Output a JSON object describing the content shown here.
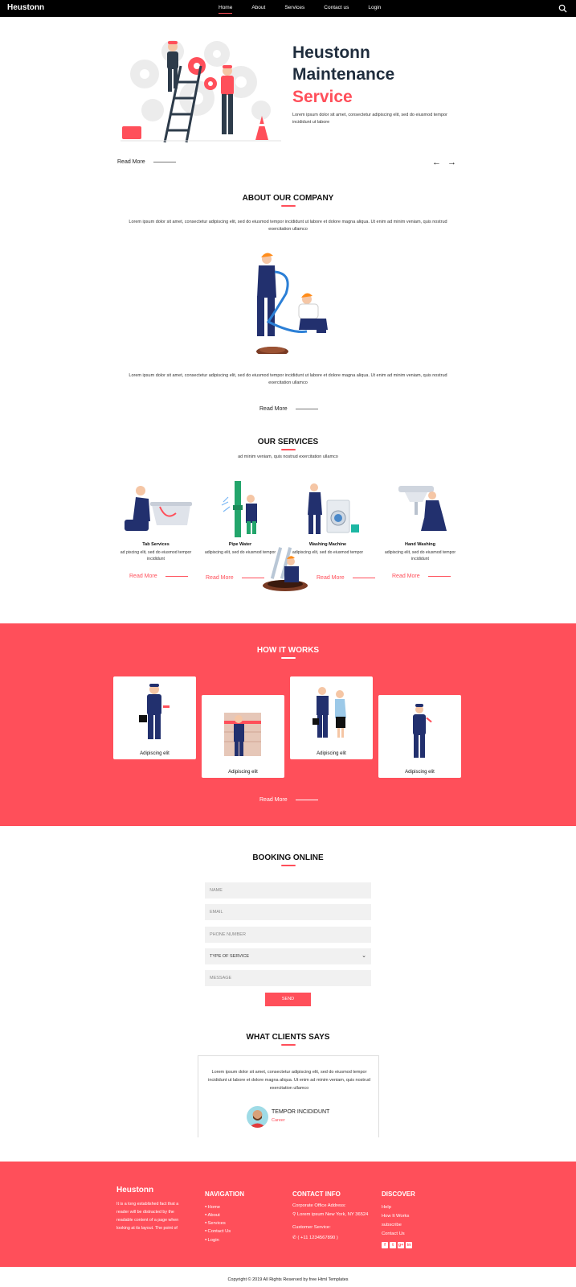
{
  "nav": {
    "brand": "Heustonn",
    "links": [
      "Home",
      "About",
      "Services",
      "Contact us",
      "Login"
    ],
    "active": "Home"
  },
  "hero": {
    "title_line1": "Heustonn",
    "title_line2": "Maintenance",
    "title_accent": "Service",
    "text": "Lorem ipsum dolor sit amet, consectetur adipiscing elit, sed do eiusmod tempor incididunt ut labore",
    "read_more": "Read More",
    "prev_arrow": "←",
    "next_arrow": "→"
  },
  "about": {
    "title": "ABOUT OUR COMPANY",
    "para1": "Lorem ipsum dolor sit amet, consectetur adipiscing elit, sed do eiusmod tempor incididunt ut labore et dolore magna aliqua. Ut enim ad minim veniam, quis nostrud exercitation ullamco",
    "para2": "Lorem ipsum dolor sit amet, consectetur adipiscing elit, sed do eiusmod tempor incididunt ut labore et dolore magna aliqua. Ut enim ad minim veniam, quis nostrud exercitation ullamco",
    "read_more": "Read More"
  },
  "services": {
    "title": "OUR SERVICES",
    "subtitle": "ad minim veniam, quis nostrud exercitation ullamco",
    "items": [
      {
        "name": "Tab Services",
        "desc": "ad piscing elit, sed do eiusmod tempor incididunt",
        "read_more": "Read More"
      },
      {
        "name": "Pipe Water",
        "desc": "adipiscing elit, sed do eiusmod tempor",
        "read_more": "Read More"
      },
      {
        "name": "Washing Machine",
        "desc": "adipiscing elit, sed do eiusmod tempor",
        "read_more": "Read More"
      },
      {
        "name": "Hand Washing",
        "desc": "adipiscing elit, sed do eiusmod tempor incididunt",
        "read_more": "Read More"
      }
    ]
  },
  "how": {
    "title": "HOW IT WORKS",
    "cards": [
      "Adipiscing elit",
      "Adipiscing elit",
      "Adipiscing elit",
      "Adipiscing elit"
    ],
    "read_more": "Read More"
  },
  "booking": {
    "title": "BOOKING ONLINE",
    "name_ph": "NAME",
    "email_ph": "EMAIL",
    "phone_ph": "PHONE NUMBER",
    "service_selected": "TYPE OF SERVICE",
    "message_ph": "MESSAGE",
    "send": "SEND"
  },
  "clients": {
    "title": "WHAT CLIENTS SAYS",
    "quote": "Lorem ipsum dolor sit amet, consectetur adipiscing elit, sed do eiusmod tempor incididunt ut labore et dolore magna aliqua. Ut enim ad minim veniam, quis nostrud exercitation ullamco",
    "name": "TEMPOR INCIDIDUNT",
    "role": "Career"
  },
  "footer": {
    "brand": "Heustonn",
    "about": "It is a long established fact that a reader will be distracted by the readable content of a page when looking at its layout. The point of",
    "nav_title": "NAVIGATION",
    "nav_items": [
      "Home",
      "About",
      "Services",
      "Contact Us",
      "Login"
    ],
    "contact_title": "CONTACT INFO",
    "office_label": "Corporate Office Address:",
    "office_value": "Lorem ipsum New York, NY 36524",
    "service_label": "Customer Service:",
    "service_value": "( +11 1234567890 )",
    "discover_title": "DISCOVER",
    "discover_items": [
      "Help",
      "How It Works",
      "subscribe",
      "Contact Us"
    ],
    "socials": [
      "f",
      "t",
      "g+",
      "in"
    ],
    "copyright": "Copyright © 2019 All Rights Reserved by free Html Templates"
  },
  "colors": {
    "accent": "#ff4f5a",
    "dark": "#1f2d3d",
    "navy": "#22306e",
    "nav_bg": "#000000"
  }
}
